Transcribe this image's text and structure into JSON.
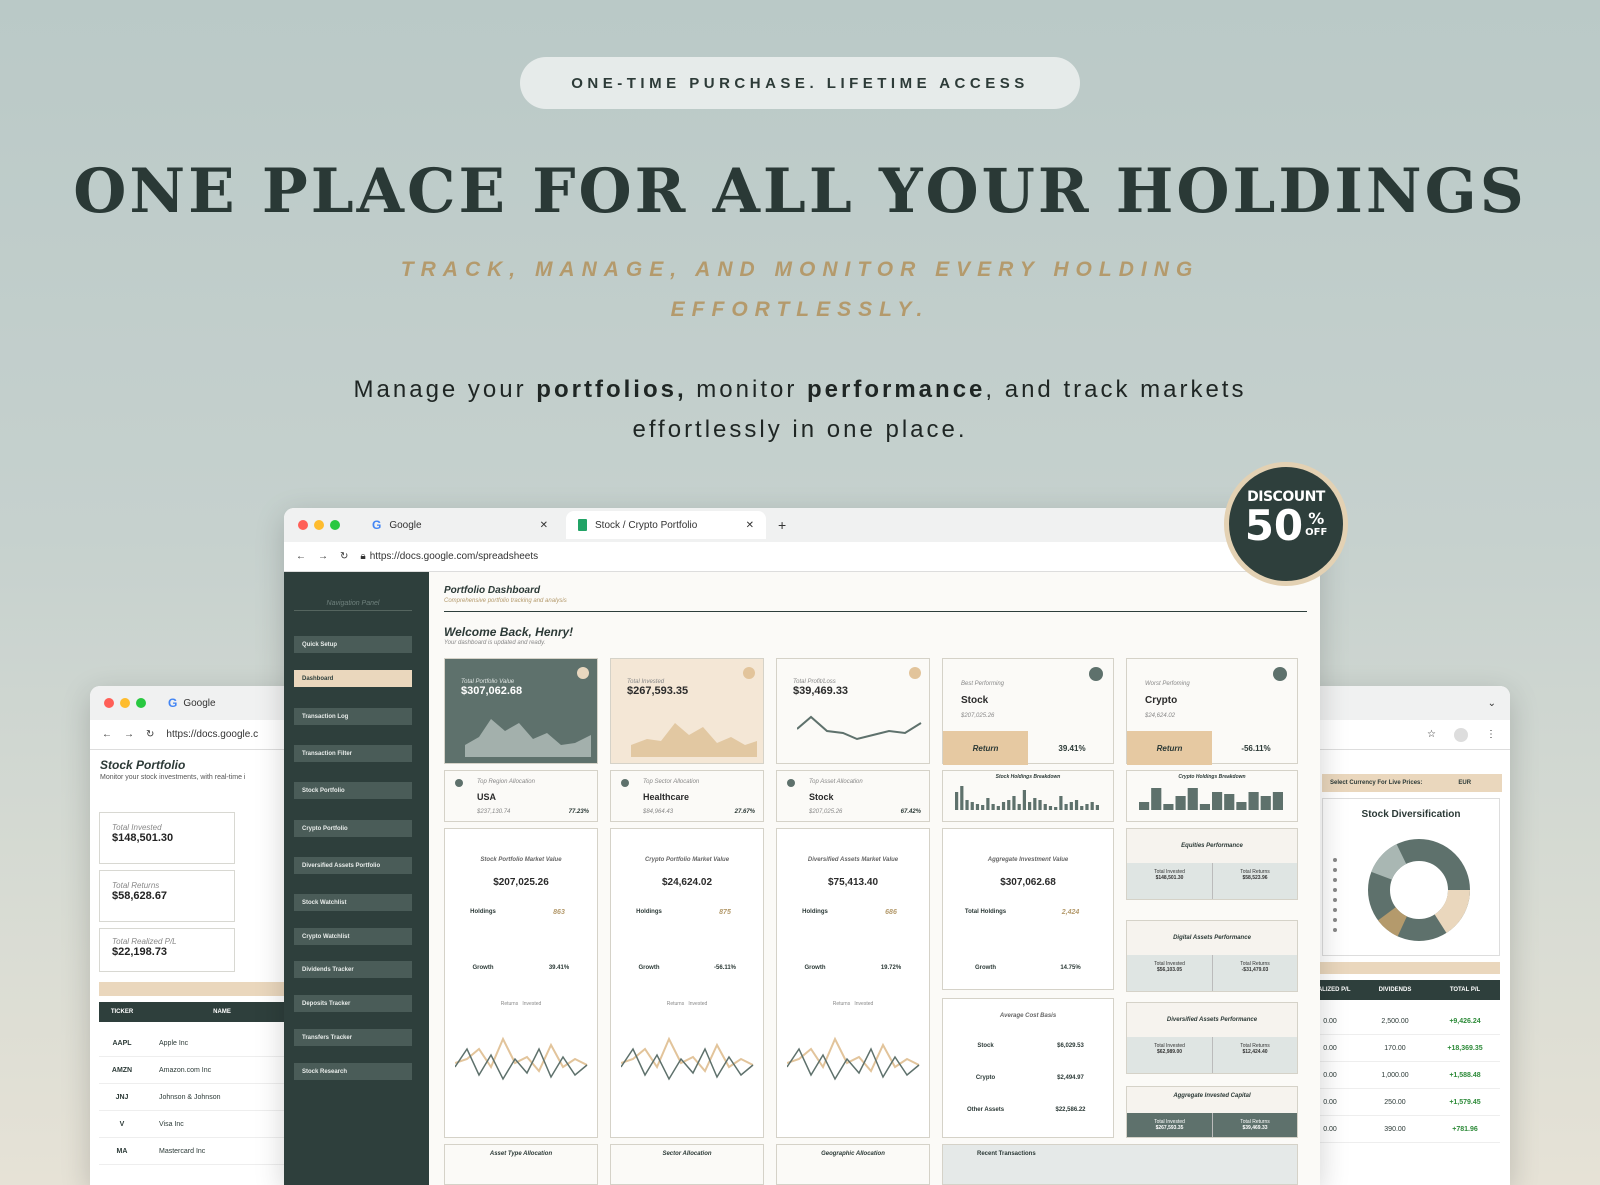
{
  "banner": {
    "pill": "ONE-TIME PURCHASE. LIFETIME ACCESS",
    "title": "ONE PLACE FOR ALL YOUR HOLDINGS",
    "subtitle": "TRACK, MANAGE, AND MONITOR EVERY HOLDING EFFORTLESSLY.",
    "desc1": "Manage your ",
    "desc_b1": "portfolios,",
    "desc2": " monitor ",
    "desc_b2": "performance",
    "desc3": ", and track markets effortlessly in one place."
  },
  "discount": {
    "line1": "DISCOUNT",
    "num": "50",
    "pct": "%",
    "off": "OFF"
  },
  "browser": {
    "tab1": "Google",
    "tab2": "Stock / Crypto Portfolio",
    "url": "https://docs.google.com/spreadsheets",
    "url_short": "https://docs.google.c"
  },
  "left": {
    "title": "Stock Portfolio",
    "subtitle": "Monitor your stock investments, with real-time i",
    "cards": [
      {
        "label": "Total Invested",
        "value": "$148,501.30"
      },
      {
        "label": "Total Returns",
        "value": "$58,628.67"
      },
      {
        "label": "Total Realized P/L",
        "value": "$22,198.73"
      }
    ],
    "headers": [
      "TICKER",
      "NAME"
    ],
    "rows": [
      [
        "AAPL",
        "Apple Inc"
      ],
      [
        "AMZN",
        "Amazon.com Inc"
      ],
      [
        "JNJ",
        "Johnson & Johnson"
      ],
      [
        "V",
        "Visa Inc"
      ],
      [
        "MA",
        "Mastercard Inc"
      ]
    ]
  },
  "right": {
    "currency_label": "Select Currency For Live Prices:",
    "currency": "EUR",
    "div_title": "Stock Diversification",
    "headers": [
      "REALIZED P/L",
      "DIVIDENDS",
      "TOTAL P/L"
    ],
    "rows": [
      [
        "0.00",
        "2,500.00",
        "+9,426.24"
      ],
      [
        "0.00",
        "170.00",
        "+18,369.35"
      ],
      [
        "0.00",
        "1,000.00",
        "+1,588.48"
      ],
      [
        "0.00",
        "250.00",
        "+1,579.45"
      ],
      [
        "0.00",
        "390.00",
        "+781.96"
      ]
    ]
  },
  "dash": {
    "nav_title": "Navigation Panel",
    "nav": [
      "Quick Setup",
      "Dashboard",
      "Transaction Log",
      "Transaction Filter",
      "Stock Portfolio",
      "Crypto Portfolio",
      "Diversified Assets Portfolio",
      "Stock Watchlist",
      "Crypto Watchlist",
      "Dividends Tracker",
      "Deposits Tracker",
      "Transfers Tracker",
      "Stock Research"
    ],
    "title": "Portfolio Dashboard",
    "subtitle": "Comprehensive portfolio tracking and analysis",
    "welcome": "Welcome Back, Henry!",
    "welcome_sub": "Your dashboard is updated and ready.",
    "kpis": [
      {
        "label": "Total Portfolio Value",
        "value": "$307,062.68"
      },
      {
        "label": "Total Invested",
        "value": "$267,593.35"
      },
      {
        "label": "Total Profit/Loss",
        "value": "$39,469.33"
      }
    ],
    "best": {
      "label": "Best Performing",
      "name": "Stock",
      "amount": "$207,025.26",
      "ret_label": "Return",
      "ret": "39.41%"
    },
    "worst": {
      "label": "Worst Perfoming",
      "name": "Crypto",
      "amount": "$24,624.02",
      "ret_label": "Return",
      "ret": "-56.11%"
    },
    "alloc": [
      {
        "label": "Top Region Allocation",
        "name": "USA",
        "amount": "$237,130.74",
        "pct": "77.23%"
      },
      {
        "label": "Top Sector Allocation",
        "name": "Healthcare",
        "amount": "$84,964.43",
        "pct": "27.67%"
      },
      {
        "label": "Top Asset Allocation",
        "name": "Stock",
        "amount": "$207,025.26",
        "pct": "67.42%"
      }
    ],
    "breakdowns": [
      "Stock Holdings Breakdown",
      "Crypto Holdings Breakdown"
    ],
    "markets": [
      {
        "title": "Stock Portfolio Market Value",
        "value": "$207,025.26",
        "h_label": "Holdings",
        "holdings": "863",
        "g_label": "Growth",
        "growth": "39.41%"
      },
      {
        "title": "Crypto Portfolio Market Value",
        "value": "$24,624.02",
        "h_label": "Holdings",
        "holdings": "875",
        "g_label": "Growth",
        "growth": "-56.11%"
      },
      {
        "title": "Diversified Assets Market Value",
        "value": "$75,413.40",
        "h_label": "Holdings",
        "holdings": "686",
        "g_label": "Growth",
        "growth": "19.72%"
      }
    ],
    "aggregate": {
      "title": "Aggregate Investment Value",
      "value": "$307,062.68",
      "h_label": "Total Holdings",
      "holdings": "2,424",
      "g_label": "Growth",
      "growth": "14.75%"
    },
    "avgcost": {
      "title": "Average Cost Basis",
      "rows": [
        [
          "Stock",
          "$6,029.53"
        ],
        [
          "Crypto",
          "$2,494.97"
        ],
        [
          "Other Assets",
          "$22,586.22"
        ]
      ]
    },
    "perf": [
      {
        "title": "Equities Performance",
        "a_label": "Total Invested",
        "a": "$148,501.30",
        "b_label": "Total Returns",
        "b": "$58,523.96"
      },
      {
        "title": "Digital Assets Performance",
        "a_label": "Total Invested",
        "a": "$56,103.05",
        "b_label": "Total Returns",
        "b": "-$31,479.03"
      },
      {
        "title": "Diversified Assets Performance",
        "a_label": "Total Invested",
        "a": "$62,989.00",
        "b_label": "Total Returns",
        "b": "$12,424.40"
      },
      {
        "title": "Aggregate Invested Capital",
        "a_label": "Total Invested",
        "a": "$267,593.35",
        "b_label": "Total Returns",
        "b": "$39,469.33"
      }
    ],
    "bottom": [
      "Asset Type Allocation",
      "Sector Allocation",
      "Geographic Allocation",
      "Recent Transactions"
    ],
    "legend_ret": "Returns",
    "legend_inv": "Invested"
  },
  "colors": {
    "dark": "#2e3f3c",
    "peach": "#ead7bd",
    "gold": "#b49a6c"
  }
}
